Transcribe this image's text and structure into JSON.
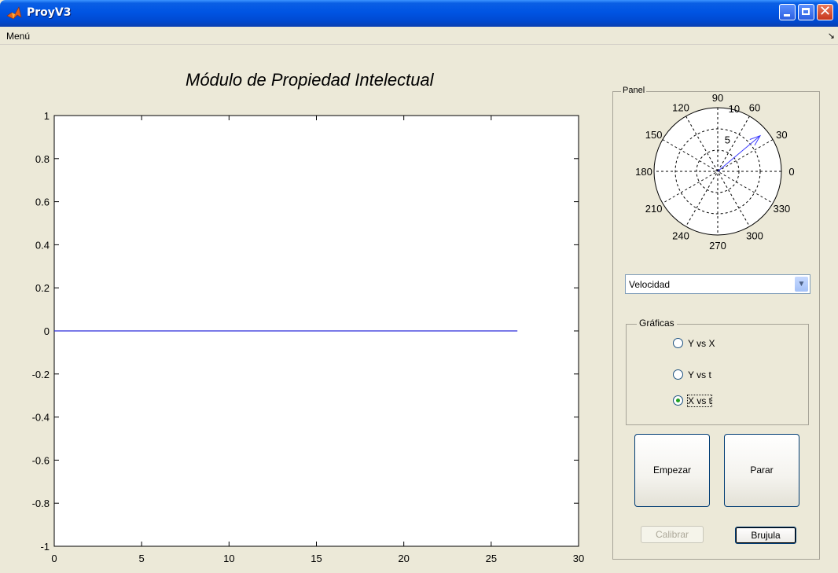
{
  "window": {
    "title": "ProyV3"
  },
  "menu": {
    "items": [
      "Menú"
    ]
  },
  "plot": {
    "title": "Módulo de Propiedad Intelectual",
    "line_color": "#2b2bd9"
  },
  "panel": {
    "label": "Panel",
    "polar": {
      "angle_labels": [
        "90",
        "60",
        "30",
        "0",
        "330",
        "300",
        "270",
        "240",
        "210",
        "180",
        "150",
        "120"
      ],
      "radius_labels": [
        "5",
        "10"
      ],
      "vector_color": "#3a3aff",
      "vector_angle_deg": 40,
      "vector_magnitude": 10
    },
    "dropdown": {
      "selected": "Velocidad"
    },
    "graficas": {
      "label": "Gráficas",
      "options": [
        {
          "label": "Y vs X",
          "selected": false
        },
        {
          "label": "Y vs t",
          "selected": false
        },
        {
          "label": "X vs t",
          "selected": true
        }
      ]
    },
    "buttons": {
      "start": "Empezar",
      "stop": "Parar",
      "calibrate": "Calibrar",
      "compass": "Brujula"
    }
  },
  "chart_data": {
    "type": "line",
    "title": "Módulo de Propiedad Intelectual",
    "xlabel": "",
    "ylabel": "",
    "xlim": [
      0,
      30
    ],
    "ylim": [
      -1,
      1
    ],
    "xticks": [
      0,
      5,
      10,
      15,
      20,
      25,
      30
    ],
    "yticks": [
      -1,
      -0.8,
      -0.6,
      -0.4,
      -0.2,
      0,
      0.2,
      0.4,
      0.6,
      0.8,
      1
    ],
    "series": [
      {
        "x": [
          0,
          26.5
        ],
        "y": [
          0,
          0
        ]
      }
    ],
    "grid": false
  }
}
